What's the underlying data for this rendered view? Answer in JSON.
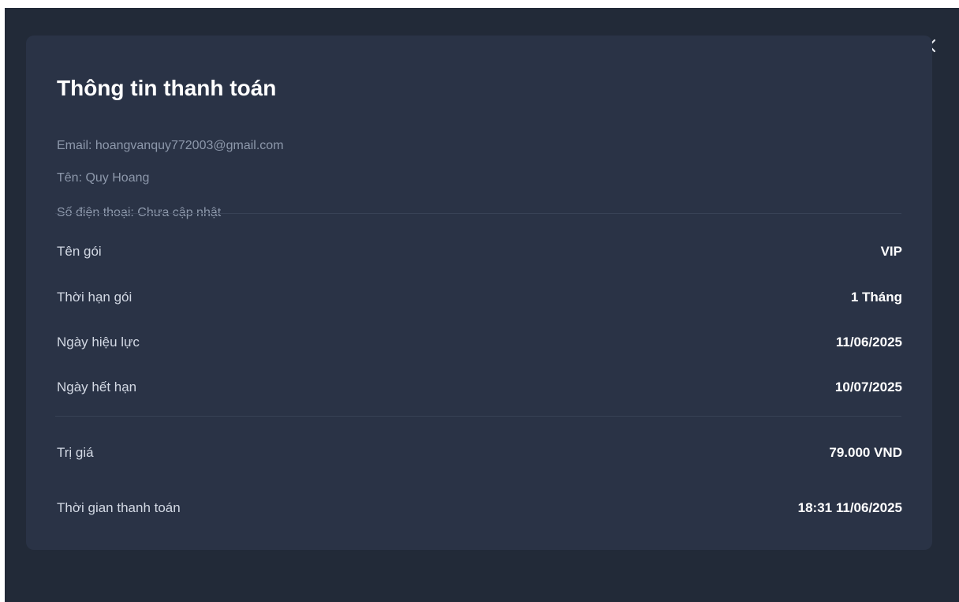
{
  "dialog": {
    "close_icon": "close-icon",
    "title": "Thông tin thanh toán",
    "user": {
      "email": "Email: hoangvanquy772003@gmail.com",
      "name": "Tên: Quy Hoang",
      "phone": "Số điện thoại: Chưa cập nhật"
    },
    "package_rows": [
      {
        "label": "Tên gói",
        "value": "VIP"
      },
      {
        "label": "Thời hạn gói",
        "value": "1 Tháng"
      },
      {
        "label": "Ngày hiệu lực",
        "value": "11/06/2025"
      },
      {
        "label": "Ngày hết hạn",
        "value": "10/07/2025"
      }
    ],
    "payment_rows": [
      {
        "label": "Trị giá",
        "value": "79.000 VND"
      },
      {
        "label": "Thời gian thanh toán",
        "value": "18:31 11/06/2025"
      }
    ]
  },
  "colors": {
    "overlay_bg": "#222a38",
    "card_bg": "#2a3346",
    "muted_text": "#8d98ab",
    "label_text": "#d3d9e4",
    "value_text": "#ffffff"
  }
}
